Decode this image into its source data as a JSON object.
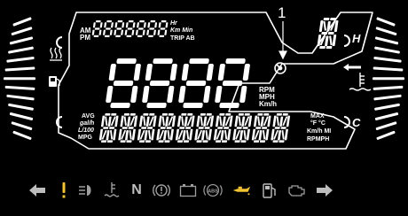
{
  "callout": {
    "number": "1"
  },
  "odometer": {
    "am_pm_top": "AM",
    "am_pm_bottom": "PM",
    "units_top": "Hr",
    "units_mid": "Km Min",
    "units_bottom": "TRIP AB"
  },
  "speed_units": {
    "rpm": "RPM",
    "mph": "MPH",
    "kmh": "Km/h"
  },
  "fuel_units": {
    "avg": "AVG",
    "galh": "gal/h",
    "l100": "L/100",
    "mpg": "MPG"
  },
  "right_units": {
    "max": "MAX",
    "degrees": "°F °C",
    "kmh_mi": "Km/h MI",
    "rpmph": "RPMPH"
  },
  "gauge_labels": {
    "hot": "H",
    "cold": "C"
  },
  "indicators": [
    {
      "name": "left-turn-arrow-icon",
      "color": "#bdbdbd"
    },
    {
      "name": "warning-exclamation-icon",
      "color": "#f1c232"
    },
    {
      "name": "high-beam-icon",
      "color": "#9e9e9e"
    },
    {
      "name": "coolant-temperature-icon",
      "color": "#9e9e9e"
    },
    {
      "name": "neutral-indicator",
      "label": "N",
      "color": "#bdbdbd"
    },
    {
      "name": "brake-warning-icon",
      "color": "#9e9e9e"
    },
    {
      "name": "battery-icon",
      "color": "#9e9e9e"
    },
    {
      "name": "abs-icon",
      "label": "(ABS)",
      "color": "#9e9e9e"
    },
    {
      "name": "oil-pressure-icon",
      "color": "#f1c232"
    },
    {
      "name": "fuel-pump-icon",
      "color": "#bdbdbd"
    },
    {
      "name": "check-engine-icon",
      "color": "#9e9e9e"
    },
    {
      "name": "right-turn-arrow-icon",
      "color": "#bdbdbd"
    }
  ],
  "colors": {
    "panel": "#000000",
    "segments": "#ffffff",
    "outline": "#ffffff"
  }
}
